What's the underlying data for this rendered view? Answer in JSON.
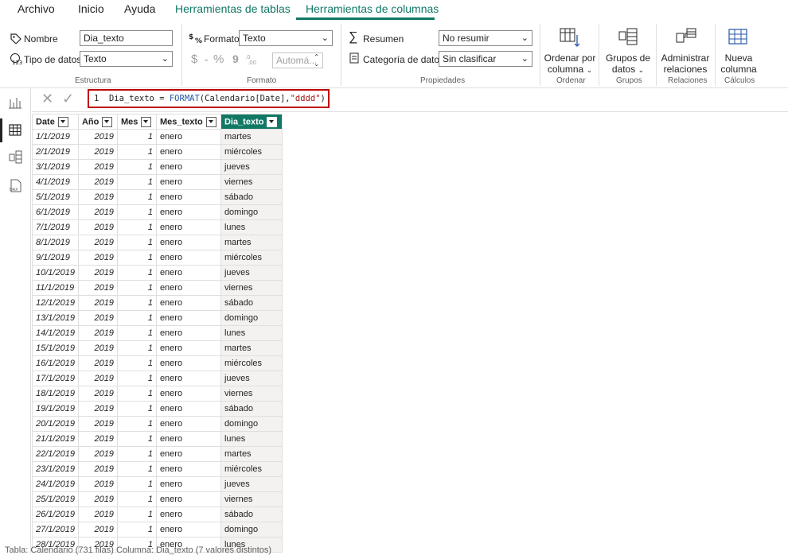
{
  "tabs": [
    {
      "label": "Archivo"
    },
    {
      "label": "Inicio"
    },
    {
      "label": "Ayuda"
    },
    {
      "label": "Herramientas de tablas"
    },
    {
      "label": "Herramientas de columnas"
    }
  ],
  "ribbon": {
    "estructura": {
      "nombre_label": "Nombre",
      "nombre_value": "Dia_texto",
      "tipo_label": "Tipo de datos",
      "tipo_value": "Texto",
      "group_label": "Estructura"
    },
    "formato": {
      "formato_label": "Formato",
      "formato_value": "Texto",
      "currency_symbol": "$",
      "percent_symbol": "%",
      "comma_symbol": "9",
      "decimals_value": "Automá...",
      "group_label": "Formato"
    },
    "propiedades": {
      "resumen_label": "Resumen",
      "resumen_value": "No resumir",
      "categoria_label": "Categoría de datos",
      "categoria_value": "Sin clasificar",
      "group_label": "Propiedades"
    },
    "ordenar": {
      "line1": "Ordenar por",
      "line2": "columna",
      "group_label": "Ordenar"
    },
    "grupos": {
      "line1": "Grupos de",
      "line2": "datos",
      "group_label": "Grupos"
    },
    "relaciones": {
      "line1": "Administrar",
      "line2": "relaciones",
      "group_label": "Relaciones"
    },
    "calculos": {
      "line1": "Nueva",
      "line2": "columna",
      "group_label": "Cálculos"
    }
  },
  "formula_bar": {
    "line_number": "1",
    "measure_name": "Dia_texto",
    "equals": " = ",
    "function": "FORMAT",
    "args_open": "(Calendario[Date],",
    "format_string": "\"dddd\"",
    "args_close": ")"
  },
  "table": {
    "columns": [
      "Date",
      "Año",
      "Mes",
      "Mes_texto",
      "Dia_texto"
    ],
    "rows": [
      [
        "1/1/2019",
        "2019",
        "1",
        "enero",
        "martes"
      ],
      [
        "2/1/2019",
        "2019",
        "1",
        "enero",
        "miércoles"
      ],
      [
        "3/1/2019",
        "2019",
        "1",
        "enero",
        "jueves"
      ],
      [
        "4/1/2019",
        "2019",
        "1",
        "enero",
        "viernes"
      ],
      [
        "5/1/2019",
        "2019",
        "1",
        "enero",
        "sábado"
      ],
      [
        "6/1/2019",
        "2019",
        "1",
        "enero",
        "domingo"
      ],
      [
        "7/1/2019",
        "2019",
        "1",
        "enero",
        "lunes"
      ],
      [
        "8/1/2019",
        "2019",
        "1",
        "enero",
        "martes"
      ],
      [
        "9/1/2019",
        "2019",
        "1",
        "enero",
        "miércoles"
      ],
      [
        "10/1/2019",
        "2019",
        "1",
        "enero",
        "jueves"
      ],
      [
        "11/1/2019",
        "2019",
        "1",
        "enero",
        "viernes"
      ],
      [
        "12/1/2019",
        "2019",
        "1",
        "enero",
        "sábado"
      ],
      [
        "13/1/2019",
        "2019",
        "1",
        "enero",
        "domingo"
      ],
      [
        "14/1/2019",
        "2019",
        "1",
        "enero",
        "lunes"
      ],
      [
        "15/1/2019",
        "2019",
        "1",
        "enero",
        "martes"
      ],
      [
        "16/1/2019",
        "2019",
        "1",
        "enero",
        "miércoles"
      ],
      [
        "17/1/2019",
        "2019",
        "1",
        "enero",
        "jueves"
      ],
      [
        "18/1/2019",
        "2019",
        "1",
        "enero",
        "viernes"
      ],
      [
        "19/1/2019",
        "2019",
        "1",
        "enero",
        "sábado"
      ],
      [
        "20/1/2019",
        "2019",
        "1",
        "enero",
        "domingo"
      ],
      [
        "21/1/2019",
        "2019",
        "1",
        "enero",
        "lunes"
      ],
      [
        "22/1/2019",
        "2019",
        "1",
        "enero",
        "martes"
      ],
      [
        "23/1/2019",
        "2019",
        "1",
        "enero",
        "miércoles"
      ],
      [
        "24/1/2019",
        "2019",
        "1",
        "enero",
        "jueves"
      ],
      [
        "25/1/2019",
        "2019",
        "1",
        "enero",
        "viernes"
      ],
      [
        "26/1/2019",
        "2019",
        "1",
        "enero",
        "sábado"
      ],
      [
        "27/1/2019",
        "2019",
        "1",
        "enero",
        "domingo"
      ],
      [
        "28/1/2019",
        "2019",
        "1",
        "enero",
        "lunes"
      ]
    ]
  },
  "status_bar": "Tabla: Calendario (731 filas) Columna: Dia_texto (7 valores distintos)",
  "colors": {
    "accent": "#117865",
    "highlight_border": "#c00000",
    "function_color": "#2456a6",
    "string_color": "#a31515"
  },
  "icons": [
    "tag-icon",
    "datatype-icon",
    "format-icon",
    "sigma-icon",
    "category-icon",
    "sort-by-column-icon",
    "data-groups-icon",
    "manage-relationships-icon",
    "new-column-icon",
    "report-view-icon",
    "data-view-icon",
    "model-view-icon",
    "dax-query-icon",
    "cancel-icon",
    "commit-icon"
  ]
}
